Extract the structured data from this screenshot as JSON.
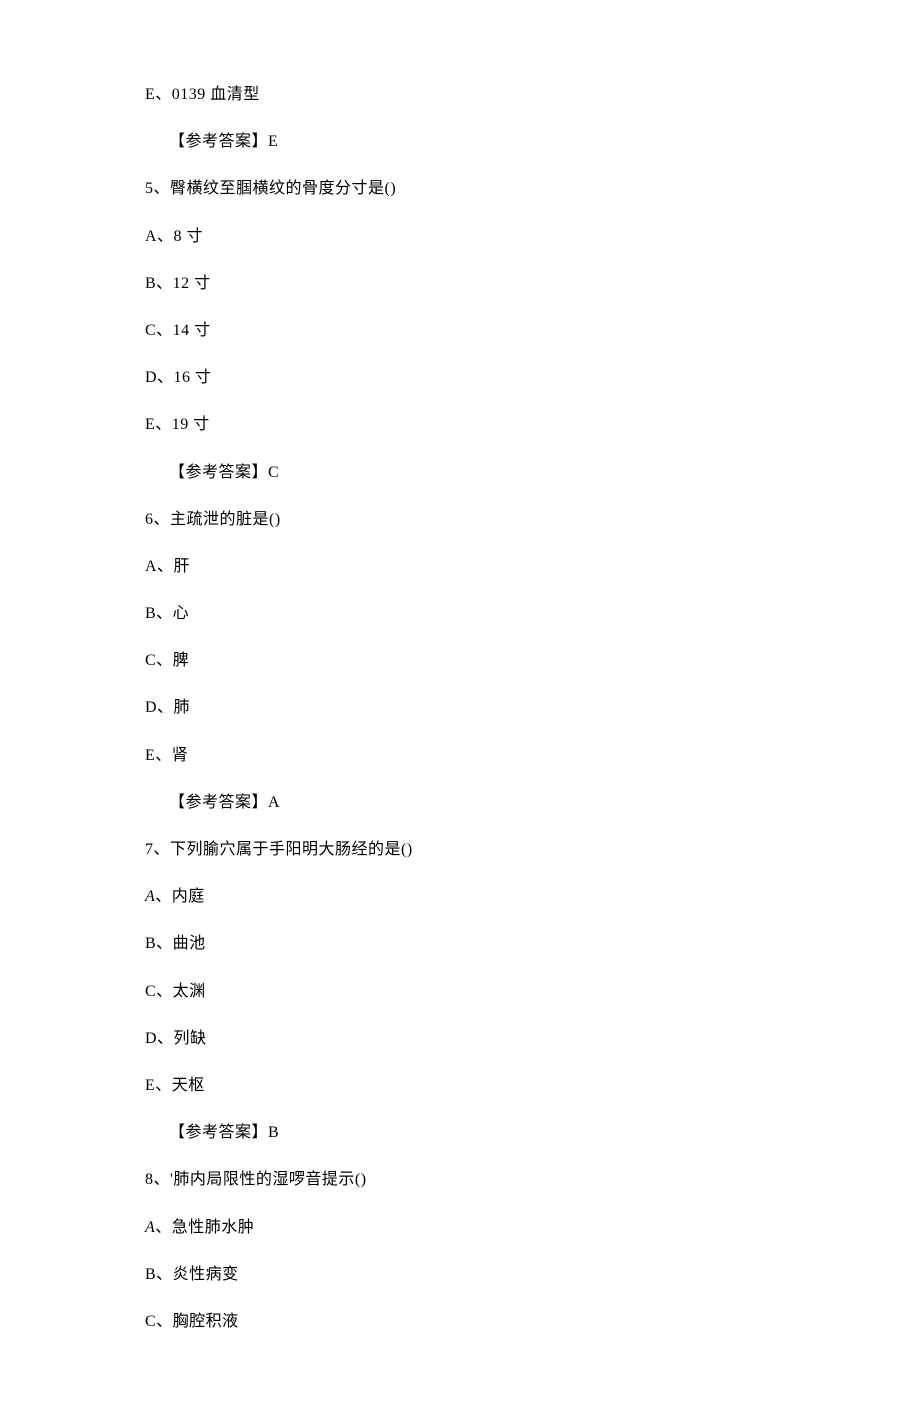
{
  "lines": [
    {
      "text": "E、0139 血清型",
      "indent": false
    },
    {
      "text": "【参考答案】E",
      "indent": true
    },
    {
      "text": "5、臀横纹至腘横纹的骨度分寸是()",
      "indent": false
    },
    {
      "text": "A、8 寸",
      "indent": false
    },
    {
      "text": "B、12 寸",
      "indent": false
    },
    {
      "text": "C、14 寸",
      "indent": false
    },
    {
      "text": "D、16 寸",
      "indent": false
    },
    {
      "text": "E、19 寸",
      "indent": false
    },
    {
      "text": "【参考答案】C",
      "indent": true
    },
    {
      "text": "6、主疏泄的脏是()",
      "indent": false
    },
    {
      "text": "A、肝",
      "indent": false
    },
    {
      "text": "B、心",
      "indent": false
    },
    {
      "text": "C、脾",
      "indent": false
    },
    {
      "text": "D、肺",
      "indent": false
    },
    {
      "text": "E、肾",
      "indent": false
    },
    {
      "text": "【参考答案】A",
      "indent": true
    },
    {
      "text": "7、下列腧穴属于手阳明大肠经的是()",
      "indent": false
    },
    {
      "text": "A、内庭",
      "indent": false,
      "italicA": true
    },
    {
      "text": "B、曲池",
      "indent": false
    },
    {
      "text": "C、太渊",
      "indent": false
    },
    {
      "text": "D、列缺",
      "indent": false
    },
    {
      "text": "E、天枢",
      "indent": false
    },
    {
      "text": "【参考答案】B",
      "indent": true
    },
    {
      "text": "8、'肺内局限性的湿啰音提示()",
      "indent": false
    },
    {
      "text": "A、急性肺水肿",
      "indent": false,
      "italicA": true
    },
    {
      "text": "B、炎性病变",
      "indent": false
    },
    {
      "text": "C、胸腔积液",
      "indent": false
    }
  ]
}
